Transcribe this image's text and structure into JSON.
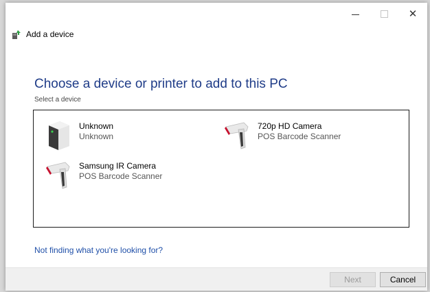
{
  "window": {
    "controls": {
      "minimize": "–",
      "maximize": "□",
      "close": "✕"
    }
  },
  "header": {
    "title": "Add a device",
    "icon": "add-device-icon"
  },
  "main": {
    "heading": "Choose a device or printer to add to this PC",
    "subheading": "Select a device",
    "devices": [
      {
        "name": "Unknown",
        "type": "Unknown",
        "icon": "unknown-device-icon"
      },
      {
        "name": "720p HD Camera",
        "type": "POS Barcode Scanner",
        "icon": "barcode-scanner-icon"
      },
      {
        "name": "Samsung IR Camera",
        "type": "POS Barcode Scanner",
        "icon": "barcode-scanner-icon"
      }
    ],
    "help_link": "Not finding what you're looking for?"
  },
  "footer": {
    "next_label": "Next",
    "cancel_label": "Cancel"
  },
  "colors": {
    "heading": "#1f3c88",
    "link": "#1f4fa8",
    "scanner_accent": "#c8102e"
  }
}
